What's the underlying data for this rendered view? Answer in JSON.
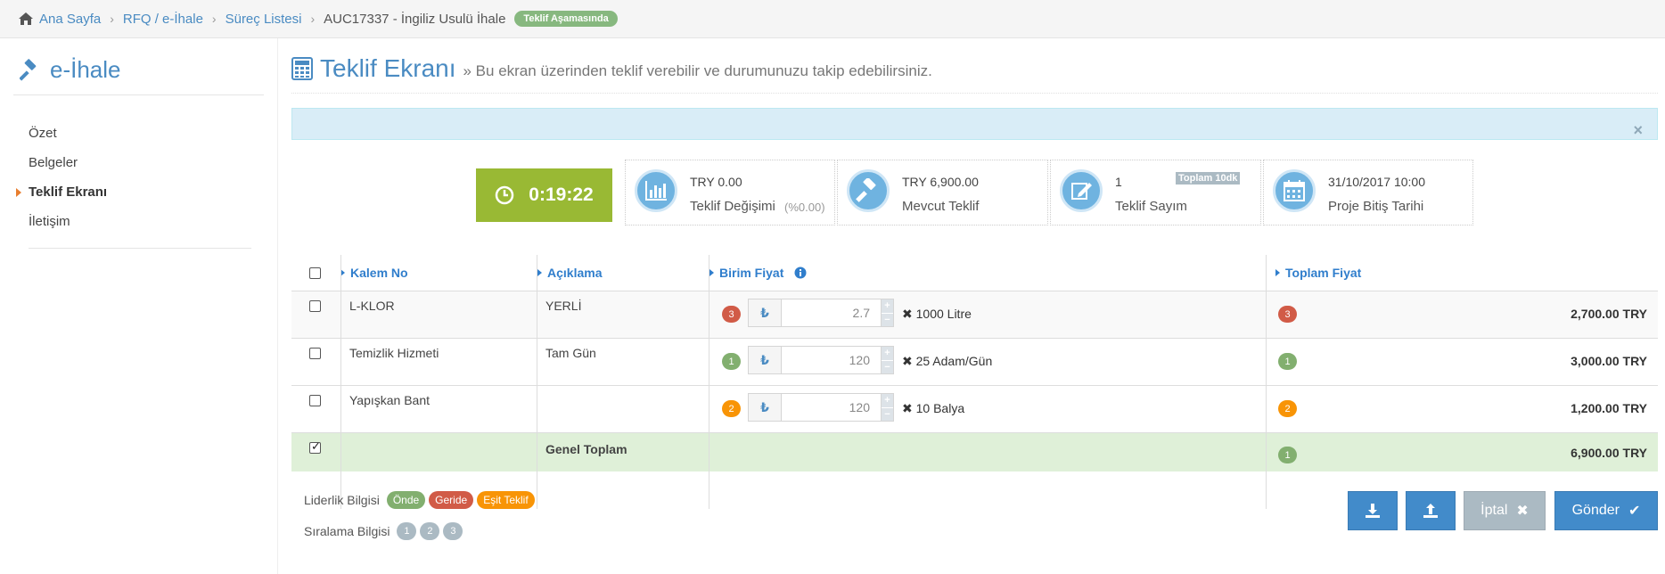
{
  "breadcrumb": {
    "home": "Ana Sayfa",
    "rfq": "RFQ / e-İhale",
    "process_list": "Süreç Listesi",
    "current": "AUC17337 - İngiliz Usulü İhale",
    "status_badge": "Teklif Aşamasında"
  },
  "sidebar": {
    "title": "e-İhale",
    "items": [
      {
        "label": "Özet"
      },
      {
        "label": "Belgeler"
      },
      {
        "label": "Teklif Ekranı"
      },
      {
        "label": "İletişim"
      }
    ]
  },
  "header": {
    "title": "Teklif Ekranı",
    "subtitle": "» Bu ekran üzerinden teklif verebilir ve durumunuzu takip edebilirsiniz."
  },
  "stats": {
    "timer": "0:19:22",
    "change_value": "TRY 0.00",
    "change_label": "Teklif Değişimi",
    "change_pct": "(%0.00)",
    "current_value": "TRY 6,900.00",
    "current_label": "Mevcut Teklif",
    "count_value": "1",
    "count_tag": "Toplam 10dk",
    "count_label": "Teklif Sayım",
    "end_value": "31/10/2017 10:00",
    "end_label": "Proje Bitiş Tarihi"
  },
  "table": {
    "headers": {
      "item_no": "Kalem No",
      "desc": "Açıklama",
      "unit_price": "Birim Fiyat",
      "total_price": "Toplam Fiyat"
    },
    "currency_symbol": "₺",
    "rows": [
      {
        "item_no": "L-KLOR",
        "desc": "YERLİ",
        "rank": "3",
        "price": "2.7",
        "qty": "✖ 1000 Litre",
        "total_rank": "3",
        "total": "2,700.00 TRY"
      },
      {
        "item_no": "Temizlik Hizmeti",
        "desc": "Tam Gün",
        "rank": "1",
        "price": "120",
        "qty": "✖ 25 Adam/Gün",
        "total_rank": "1",
        "total": "3,000.00 TRY"
      },
      {
        "item_no": "Yapışkan Bant",
        "desc": "",
        "rank": "2",
        "price": "120",
        "qty": "✖ 10 Balya",
        "total_rank": "2",
        "total": "1,200.00 TRY"
      }
    ],
    "grand_total_label": "Genel Toplam",
    "grand_total_rank": "1",
    "grand_total": "6,900.00 TRY"
  },
  "legend": {
    "leadership_label": "Liderlik Bilgisi",
    "leading": "Önde",
    "behind": "Geride",
    "equal": "Eşit Teklif",
    "rank_label": "Sıralama Bilgisi",
    "ranks": [
      "1",
      "2",
      "3"
    ]
  },
  "buttons": {
    "cancel": "İptal",
    "send": "Gönder"
  },
  "colors": {
    "accent": "#428bca",
    "timer": "#99b934",
    "leading": "#82af6f",
    "behind": "#d15b47",
    "equal": "#f89406"
  }
}
